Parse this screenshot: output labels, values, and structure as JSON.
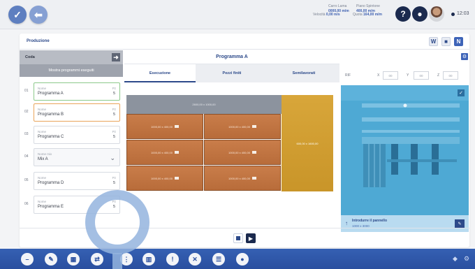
{
  "topbar": {
    "info": [
      {
        "label": "Carro Lama",
        "value": "0000,00 m/m"
      },
      {
        "label": "Piano Spintone",
        "value": "400,00 m/m"
      },
      {
        "label": "Velocità",
        "value": "0,00 m/s"
      },
      {
        "label": "Quota",
        "value": "164,00 m/m"
      }
    ],
    "time": "12:03"
  },
  "panel": {
    "title": "Produzione",
    "tools": [
      "W",
      "■",
      "N"
    ]
  },
  "queue": {
    "header": "Coda",
    "show_executed": "Mostra programmi eseguiti",
    "items": [
      {
        "num": "01",
        "small": "Nome",
        "name": "Programma A",
        "pz_label": "Pz",
        "pz": "5"
      },
      {
        "num": "02",
        "small": "Nome",
        "name": "Programma B",
        "pz_label": "Pz",
        "pz": "5"
      },
      {
        "num": "03",
        "small": "Nome",
        "name": "Programma C",
        "pz_label": "Pz",
        "pz": "5"
      },
      {
        "num": "04",
        "small": "Nome mix",
        "name": "Mix A",
        "pz_label": "",
        "pz": ""
      },
      {
        "num": "05",
        "small": "Nome",
        "name": "Programma D",
        "pz_label": "Pz",
        "pz": "5"
      },
      {
        "num": "06",
        "small": "Nome",
        "name": "Programma E",
        "pz_label": "Pz",
        "pz": "5"
      }
    ]
  },
  "program": {
    "title": "Programma A",
    "tabs": [
      "Esecuzione",
      "Pezzi finiti",
      "Semilavorati"
    ],
    "header_strip": "2600,00 x 1000,00",
    "right_strip": "600,00 x 1600,00",
    "tile_label": "1000,00 x 400,00"
  },
  "coords": {
    "rif_label": "RIF",
    "x_label": "X",
    "y_label": "Y",
    "z_label": "Z",
    "x_val": "00",
    "y_val": "00",
    "z_val": "00"
  },
  "preview": {
    "intro_title": "Introdurre il pannello",
    "intro_size": "1000 x 3000"
  },
  "colors": {
    "accent": "#2d4a8a",
    "taskbar": "#2a4f9f",
    "tile": "#c97d4a",
    "gold": "#d8a63a",
    "preview": "#4ea9d4"
  }
}
